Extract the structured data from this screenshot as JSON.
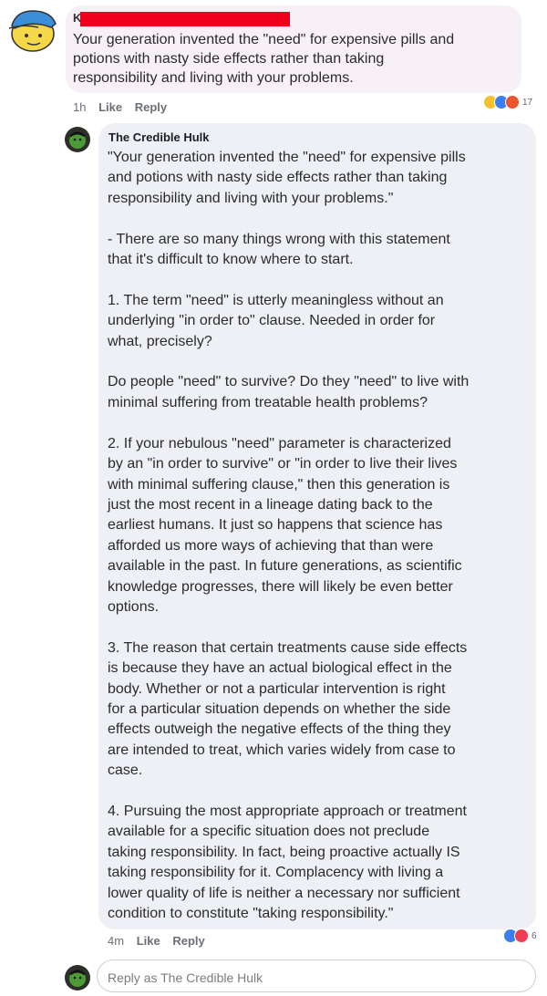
{
  "top_comment": {
    "author_initial": "K",
    "text": "Your generation invented the \"need\" for expensive pills and\npotions with nasty side effects rather than taking\nresponsibility and living with your problems.",
    "time": "1h",
    "like_label": "Like",
    "reply_label": "Reply",
    "reaction_icons": [
      "haha-icon",
      "like-icon",
      "angry-icon"
    ],
    "reaction_count": "17"
  },
  "reply_comment": {
    "author": "The Credible Hulk",
    "text": "\"Your generation invented the \"need\" for expensive pills\nand potions with nasty side effects rather than taking\nresponsibility and living with your problems.\"\n\n- There are so many things wrong with this statement\nthat it's difficult to know where to start.\n\n1. The term \"need\" is utterly meaningless without an\nunderlying \"in order to\" clause. Needed in order for\nwhat, precisely?\n\nDo people \"need\" to survive? Do they \"need\" to live with\nminimal suffering from treatable health problems?\n\n2. If your nebulous \"need\" parameter is characterized\nby an \"in order to survive\" or \"in order to live their lives\nwith minimal suffering clause,\" then this generation is\njust the most recent in a lineage dating back to the\nearliest humans. It just so happens that science has\nafforded us more ways of achieving that than were\navailable in the past. In future generations, as scientific\nknowledge progresses, there will likely be even better\noptions.\n\n3. The reason that certain treatments cause side effects\nis because they have an actual biological effect in the\nbody. Whether or not a particular intervention is right\nfor a particular situation depends on whether the side\neffects outweigh the negative effects of the thing they\nare intended to treat, which varies widely from case to\ncase.\n\n4. Pursuing the most appropriate approach or treatment\navailable for a specific situation does not preclude\ntaking responsibility. In fact, being proactive actually IS\ntaking responsibility for it. Complacency with living a\nlower quality of life is neither a necessary nor sufficient\ncondition to constitute \"taking responsibility.\"",
    "time": "4m",
    "like_label": "Like",
    "reply_label": "Reply",
    "reaction_icons": [
      "like-icon",
      "love-icon"
    ],
    "reaction_count": "6"
  },
  "reply_input": {
    "placeholder": "Reply as The Credible Hulk"
  },
  "colors": {
    "redaction": "#f0001a",
    "top_bubble": "#f7f0f7",
    "reply_bubble": "#eef0f5"
  }
}
